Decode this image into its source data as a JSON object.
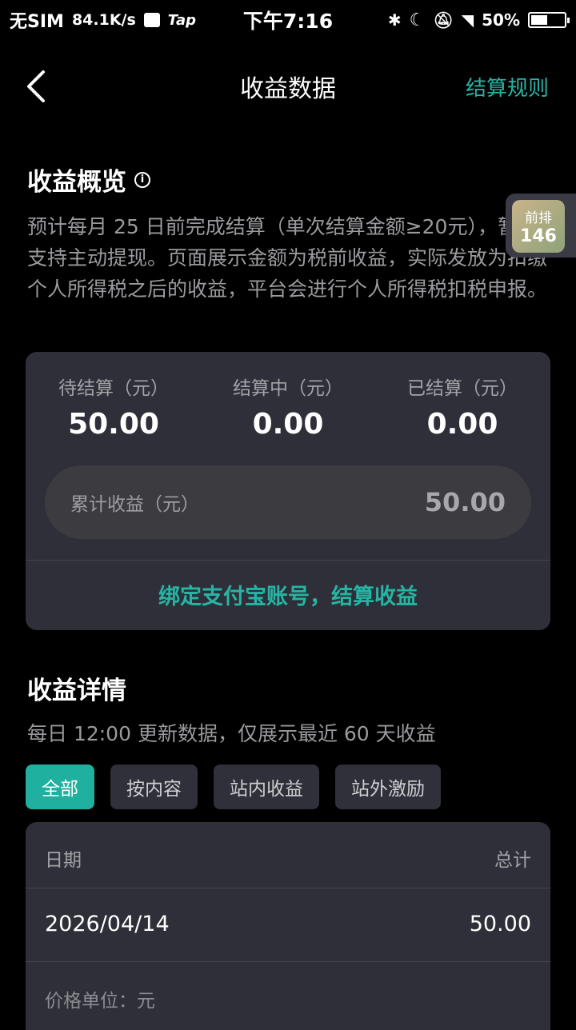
{
  "status_bar": {
    "carrier": "无SIM",
    "speed": "84.1K/s",
    "app_tag": "Tap",
    "time": "下午7:16",
    "battery": "50%",
    "battery_level": 0.5
  },
  "nav": {
    "title": "收益数据",
    "rules_label": "结算规则"
  },
  "overview": {
    "title": "收益概览",
    "description": "预计每月 25 日前完成结算（单次结算金额≥20元），暂不支持主动提现。页面展示金额为税前收益，实际发放为扣缴个人所得税之后的收益，平台会进行个人所得税扣税申报。",
    "stats": [
      {
        "label": "待结算（元）",
        "value": "50.00"
      },
      {
        "label": "结算中（元）",
        "value": "0.00"
      },
      {
        "label": "已结算（元）",
        "value": "0.00"
      }
    ],
    "total_label": "累计收益（元）",
    "total_value": "50.00",
    "bind_label": "绑定支付宝账号，结算收益"
  },
  "float_badge": {
    "line1": "前排",
    "line2": "146"
  },
  "details": {
    "title": "收益详情",
    "subtitle": "每日 12:00 更新数据，仅展示最近 60 天收益",
    "tabs": [
      "全部",
      "按内容",
      "站内收益",
      "站外激励"
    ],
    "active_tab": 0,
    "columns": [
      "日期",
      "总计"
    ],
    "rows": [
      {
        "date": "2026/04/14",
        "total": "50.00"
      }
    ],
    "unit_note": "价格单位：元"
  },
  "colors": {
    "accent": "#26b5a4",
    "background": "#000000",
    "card": "#2e2f38"
  }
}
